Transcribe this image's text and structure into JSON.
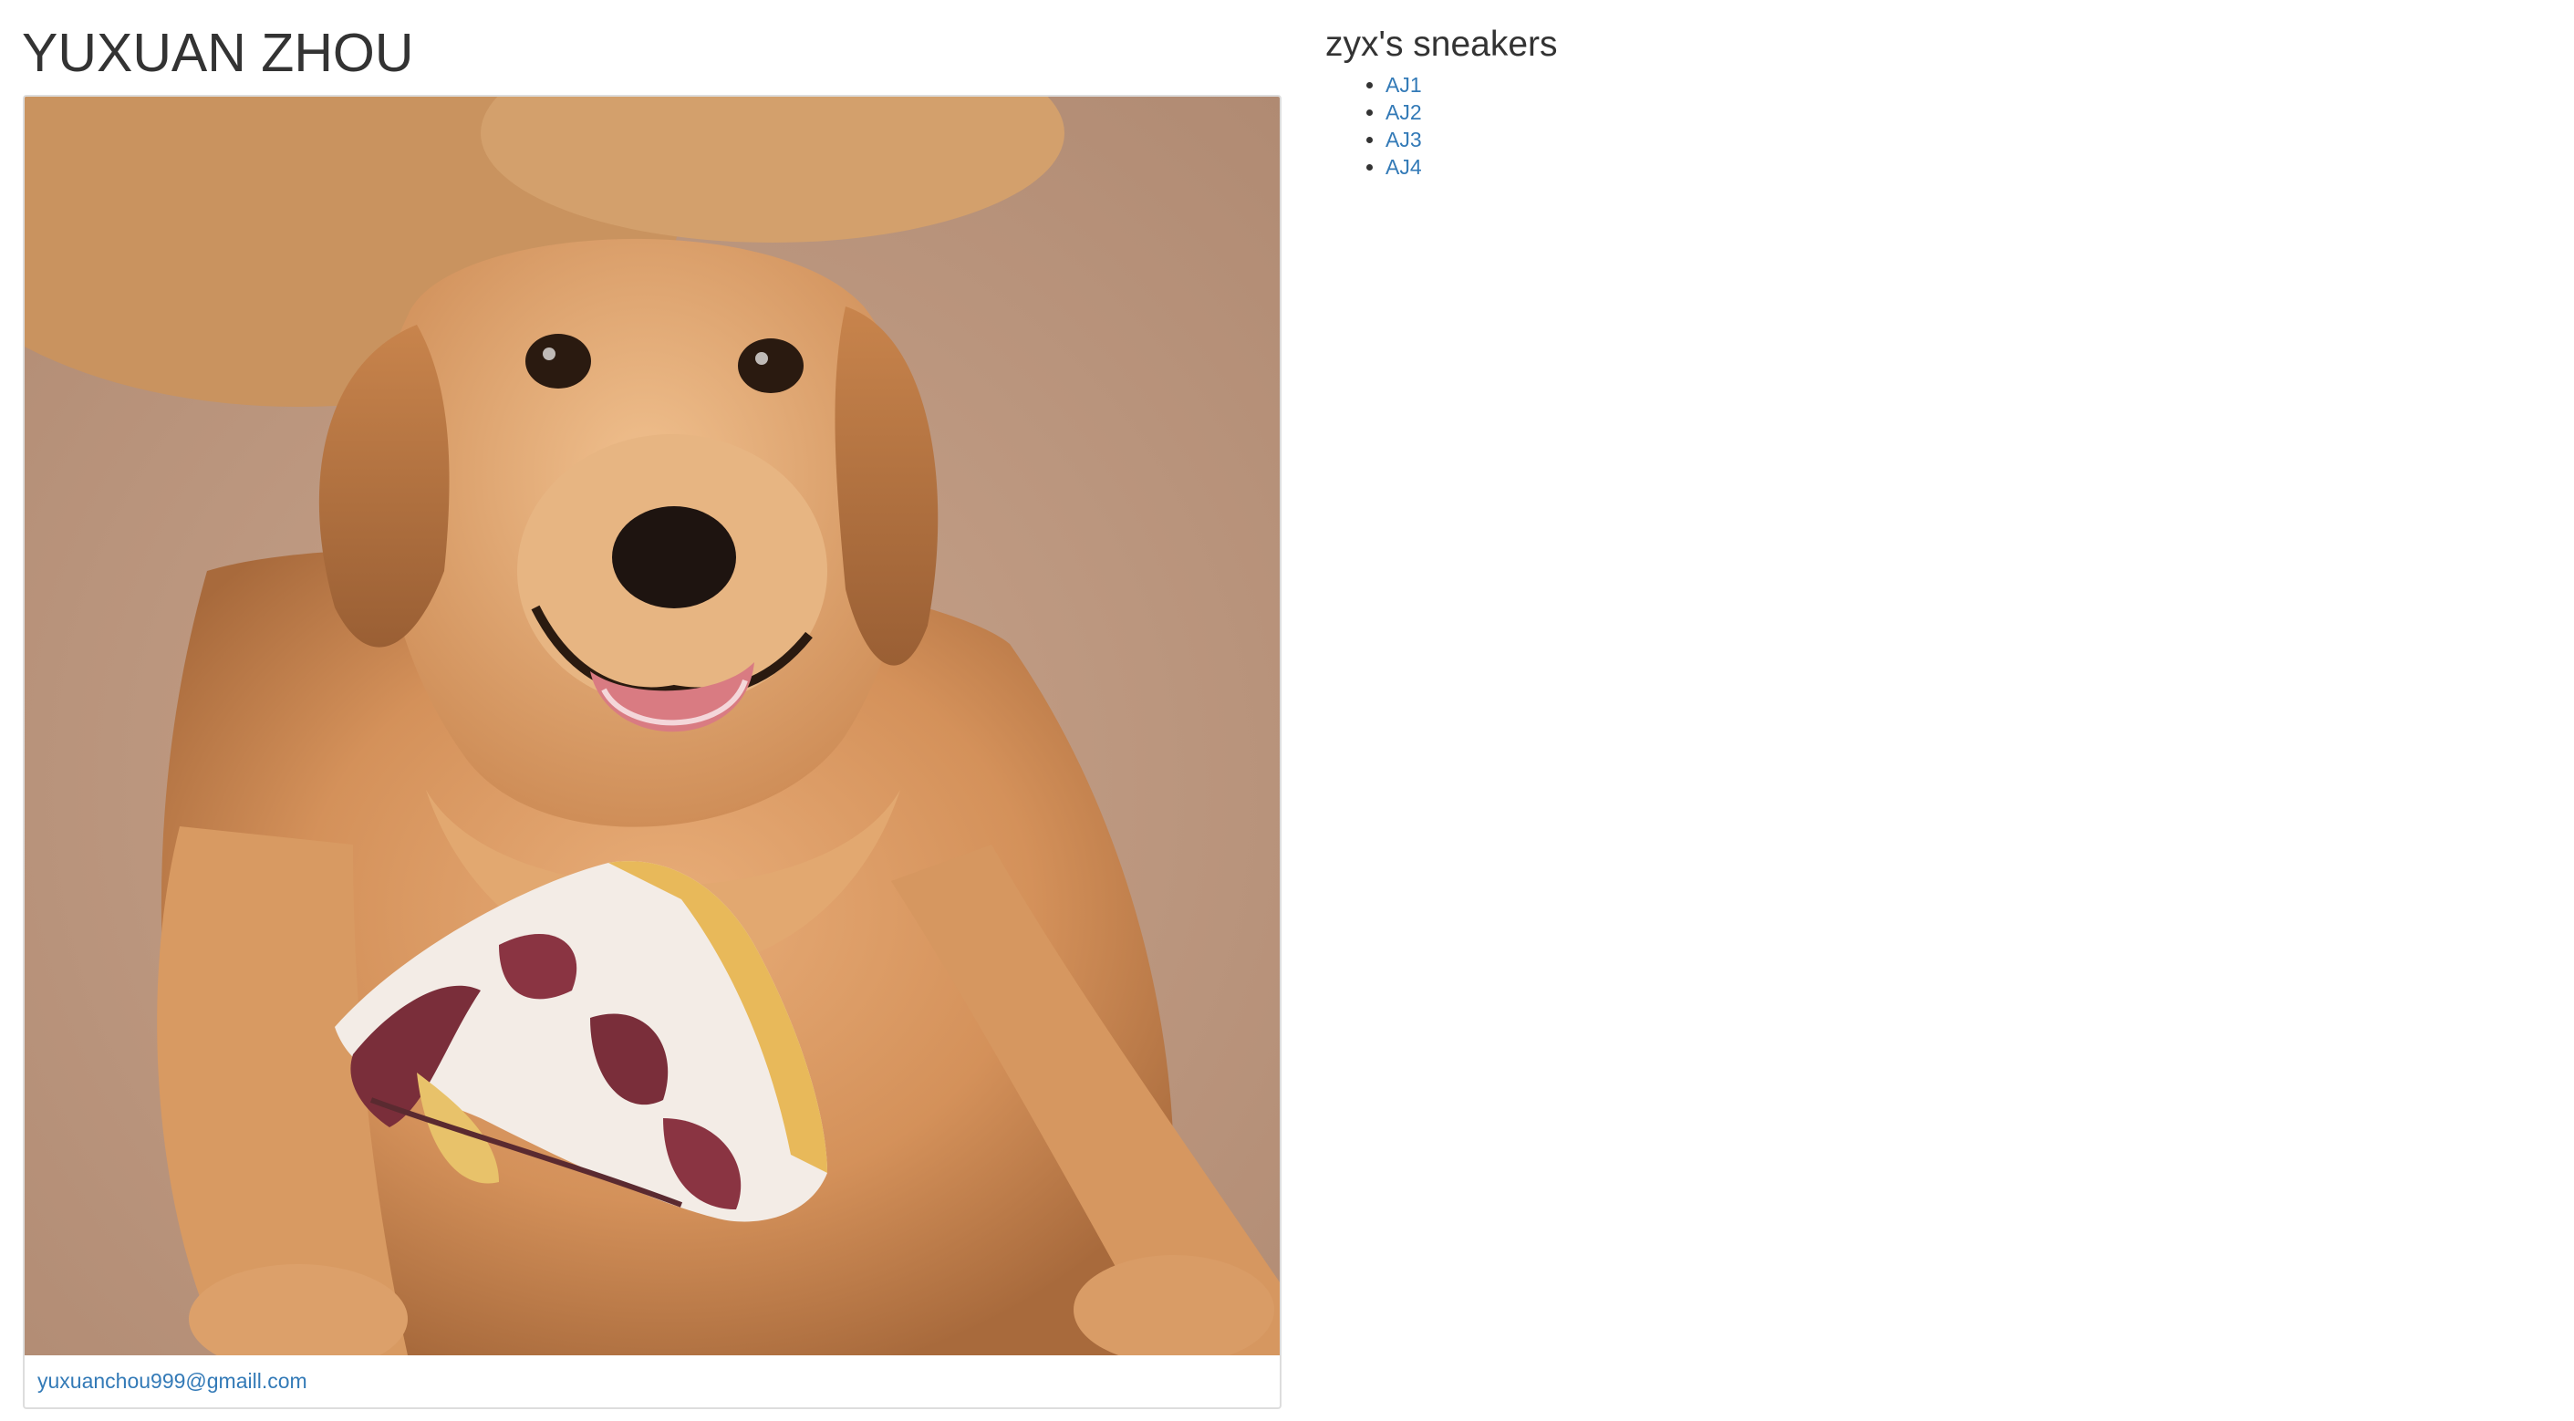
{
  "header": {
    "name": "YUXUAN ZHOU"
  },
  "profile": {
    "photo_icon": "dog-with-sneaker-photo",
    "email": "yuxuanchou999@gmaill.com"
  },
  "sneakers": {
    "title": "zyx's sneakers",
    "items": [
      {
        "label": "AJ1"
      },
      {
        "label": "AJ2"
      },
      {
        "label": "AJ3"
      },
      {
        "label": "AJ4"
      }
    ]
  },
  "colors": {
    "link": "#337ab7",
    "text": "#333333",
    "card_border": "#dddddd"
  }
}
